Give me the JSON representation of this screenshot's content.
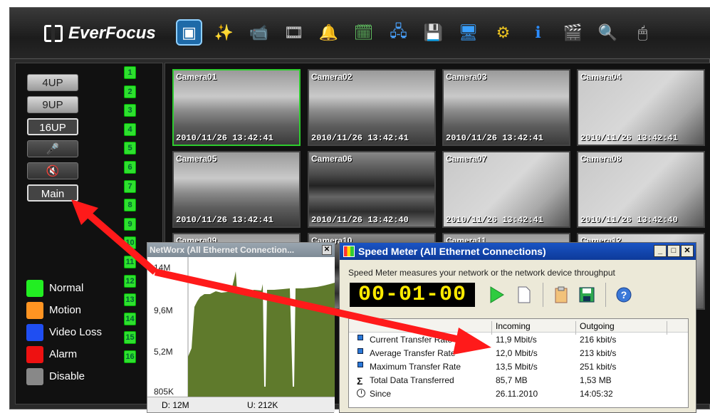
{
  "app": {
    "brand": "EverFocus",
    "toolbar_icons": [
      "monitor-icon",
      "magic-wand-icon",
      "camera-icon",
      "film-search-icon",
      "bell-icon",
      "schedule-icon",
      "network-icon",
      "disk-icon",
      "display-icon",
      "gears-icon",
      "info-icon",
      "filmstrip-icon",
      "document-search-icon",
      "mouse-icon"
    ]
  },
  "left_panel": {
    "layout_buttons": [
      "4UP",
      "9UP",
      "16UP"
    ],
    "main_button": "Main",
    "channel_numbers": [
      "1",
      "2",
      "3",
      "4",
      "5",
      "6",
      "7",
      "8",
      "9",
      "10",
      "11",
      "12",
      "13",
      "14",
      "15",
      "16"
    ],
    "legend": [
      {
        "label": "Normal",
        "color": "#22ee22"
      },
      {
        "label": "Motion",
        "color": "#ff9422"
      },
      {
        "label": "Video Loss",
        "color": "#1f4ef2"
      },
      {
        "label": "Alarm",
        "color": "#ee1111"
      },
      {
        "label": "Disable",
        "color": "#888888"
      }
    ]
  },
  "cameras": [
    {
      "name": "Camera01",
      "timestamp": "2010/11/26  13:42:41"
    },
    {
      "name": "Camera02",
      "timestamp": "2010/11/26  13:42:41"
    },
    {
      "name": "Camera03",
      "timestamp": "2010/11/26  13:42:41"
    },
    {
      "name": "Camera04",
      "timestamp": "2010/11/26  13:42:41"
    },
    {
      "name": "Camera05",
      "timestamp": "2010/11/26  13:42:41"
    },
    {
      "name": "Camera06",
      "timestamp": "2010/11/26  13:42:40"
    },
    {
      "name": "Camera07",
      "timestamp": "2010/11/26  13:42:41"
    },
    {
      "name": "Camera08",
      "timestamp": "2010/11/26  13:42:40"
    },
    {
      "name": "Camera09",
      "timestamp": ""
    },
    {
      "name": "Camera10",
      "timestamp": ""
    },
    {
      "name": "Camera11",
      "timestamp": ""
    },
    {
      "name": "Camera12",
      "timestamp": ""
    }
  ],
  "networx": {
    "title": "NetWorx (All Ethernet Connection...",
    "y_ticks": [
      "14M",
      "9,6M",
      "5,2M",
      "805K"
    ],
    "download": "D: 12M",
    "upload": "U: 212K"
  },
  "speed_meter": {
    "title": "Speed Meter (All Ethernet Connections)",
    "description": "Speed Meter measures your network or the network device throughput",
    "timer": "00-01-00",
    "columns": [
      "",
      "Incoming",
      "Outgoing"
    ],
    "rows": [
      {
        "label": "Current Transfer Rate",
        "incoming": "11,9 Mbit/s",
        "outgoing": "216 kbit/s",
        "icon": "bullet-icon"
      },
      {
        "label": "Average Transfer Rate",
        "incoming": "12,0 Mbit/s",
        "outgoing": "213 kbit/s",
        "icon": "bullet-icon"
      },
      {
        "label": "Maximum Transfer Rate",
        "incoming": "13,5 Mbit/s",
        "outgoing": "251 kbit/s",
        "icon": "bullet-icon"
      },
      {
        "label": "Total Data Transferred",
        "incoming": "85,7 MB",
        "outgoing": "1,53 MB",
        "icon": "sigma-icon"
      },
      {
        "label": "Since",
        "incoming": "26.11.2010",
        "outgoing": "14:05:32",
        "icon": "clock-icon"
      }
    ]
  }
}
